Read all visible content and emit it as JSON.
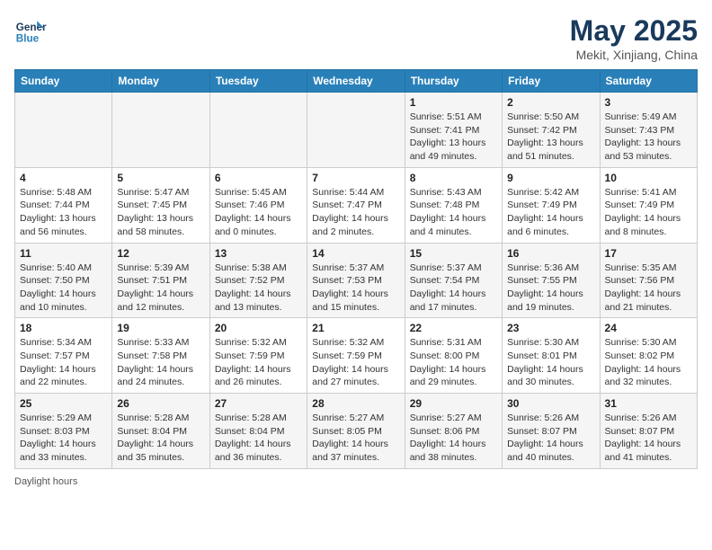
{
  "header": {
    "logo_line1": "General",
    "logo_line2": "Blue",
    "month": "May 2025",
    "location": "Mekit, Xinjiang, China"
  },
  "days_of_week": [
    "Sunday",
    "Monday",
    "Tuesday",
    "Wednesday",
    "Thursday",
    "Friday",
    "Saturday"
  ],
  "weeks": [
    [
      {
        "day": "",
        "info": ""
      },
      {
        "day": "",
        "info": ""
      },
      {
        "day": "",
        "info": ""
      },
      {
        "day": "",
        "info": ""
      },
      {
        "day": "1",
        "info": "Sunrise: 5:51 AM\nSunset: 7:41 PM\nDaylight: 13 hours\nand 49 minutes."
      },
      {
        "day": "2",
        "info": "Sunrise: 5:50 AM\nSunset: 7:42 PM\nDaylight: 13 hours\nand 51 minutes."
      },
      {
        "day": "3",
        "info": "Sunrise: 5:49 AM\nSunset: 7:43 PM\nDaylight: 13 hours\nand 53 minutes."
      }
    ],
    [
      {
        "day": "4",
        "info": "Sunrise: 5:48 AM\nSunset: 7:44 PM\nDaylight: 13 hours\nand 56 minutes."
      },
      {
        "day": "5",
        "info": "Sunrise: 5:47 AM\nSunset: 7:45 PM\nDaylight: 13 hours\nand 58 minutes."
      },
      {
        "day": "6",
        "info": "Sunrise: 5:45 AM\nSunset: 7:46 PM\nDaylight: 14 hours\nand 0 minutes."
      },
      {
        "day": "7",
        "info": "Sunrise: 5:44 AM\nSunset: 7:47 PM\nDaylight: 14 hours\nand 2 minutes."
      },
      {
        "day": "8",
        "info": "Sunrise: 5:43 AM\nSunset: 7:48 PM\nDaylight: 14 hours\nand 4 minutes."
      },
      {
        "day": "9",
        "info": "Sunrise: 5:42 AM\nSunset: 7:49 PM\nDaylight: 14 hours\nand 6 minutes."
      },
      {
        "day": "10",
        "info": "Sunrise: 5:41 AM\nSunset: 7:49 PM\nDaylight: 14 hours\nand 8 minutes."
      }
    ],
    [
      {
        "day": "11",
        "info": "Sunrise: 5:40 AM\nSunset: 7:50 PM\nDaylight: 14 hours\nand 10 minutes."
      },
      {
        "day": "12",
        "info": "Sunrise: 5:39 AM\nSunset: 7:51 PM\nDaylight: 14 hours\nand 12 minutes."
      },
      {
        "day": "13",
        "info": "Sunrise: 5:38 AM\nSunset: 7:52 PM\nDaylight: 14 hours\nand 13 minutes."
      },
      {
        "day": "14",
        "info": "Sunrise: 5:37 AM\nSunset: 7:53 PM\nDaylight: 14 hours\nand 15 minutes."
      },
      {
        "day": "15",
        "info": "Sunrise: 5:37 AM\nSunset: 7:54 PM\nDaylight: 14 hours\nand 17 minutes."
      },
      {
        "day": "16",
        "info": "Sunrise: 5:36 AM\nSunset: 7:55 PM\nDaylight: 14 hours\nand 19 minutes."
      },
      {
        "day": "17",
        "info": "Sunrise: 5:35 AM\nSunset: 7:56 PM\nDaylight: 14 hours\nand 21 minutes."
      }
    ],
    [
      {
        "day": "18",
        "info": "Sunrise: 5:34 AM\nSunset: 7:57 PM\nDaylight: 14 hours\nand 22 minutes."
      },
      {
        "day": "19",
        "info": "Sunrise: 5:33 AM\nSunset: 7:58 PM\nDaylight: 14 hours\nand 24 minutes."
      },
      {
        "day": "20",
        "info": "Sunrise: 5:32 AM\nSunset: 7:59 PM\nDaylight: 14 hours\nand 26 minutes."
      },
      {
        "day": "21",
        "info": "Sunrise: 5:32 AM\nSunset: 7:59 PM\nDaylight: 14 hours\nand 27 minutes."
      },
      {
        "day": "22",
        "info": "Sunrise: 5:31 AM\nSunset: 8:00 PM\nDaylight: 14 hours\nand 29 minutes."
      },
      {
        "day": "23",
        "info": "Sunrise: 5:30 AM\nSunset: 8:01 PM\nDaylight: 14 hours\nand 30 minutes."
      },
      {
        "day": "24",
        "info": "Sunrise: 5:30 AM\nSunset: 8:02 PM\nDaylight: 14 hours\nand 32 minutes."
      }
    ],
    [
      {
        "day": "25",
        "info": "Sunrise: 5:29 AM\nSunset: 8:03 PM\nDaylight: 14 hours\nand 33 minutes."
      },
      {
        "day": "26",
        "info": "Sunrise: 5:28 AM\nSunset: 8:04 PM\nDaylight: 14 hours\nand 35 minutes."
      },
      {
        "day": "27",
        "info": "Sunrise: 5:28 AM\nSunset: 8:04 PM\nDaylight: 14 hours\nand 36 minutes."
      },
      {
        "day": "28",
        "info": "Sunrise: 5:27 AM\nSunset: 8:05 PM\nDaylight: 14 hours\nand 37 minutes."
      },
      {
        "day": "29",
        "info": "Sunrise: 5:27 AM\nSunset: 8:06 PM\nDaylight: 14 hours\nand 38 minutes."
      },
      {
        "day": "30",
        "info": "Sunrise: 5:26 AM\nSunset: 8:07 PM\nDaylight: 14 hours\nand 40 minutes."
      },
      {
        "day": "31",
        "info": "Sunrise: 5:26 AM\nSunset: 8:07 PM\nDaylight: 14 hours\nand 41 minutes."
      }
    ]
  ],
  "footer": {
    "label": "Daylight hours"
  }
}
